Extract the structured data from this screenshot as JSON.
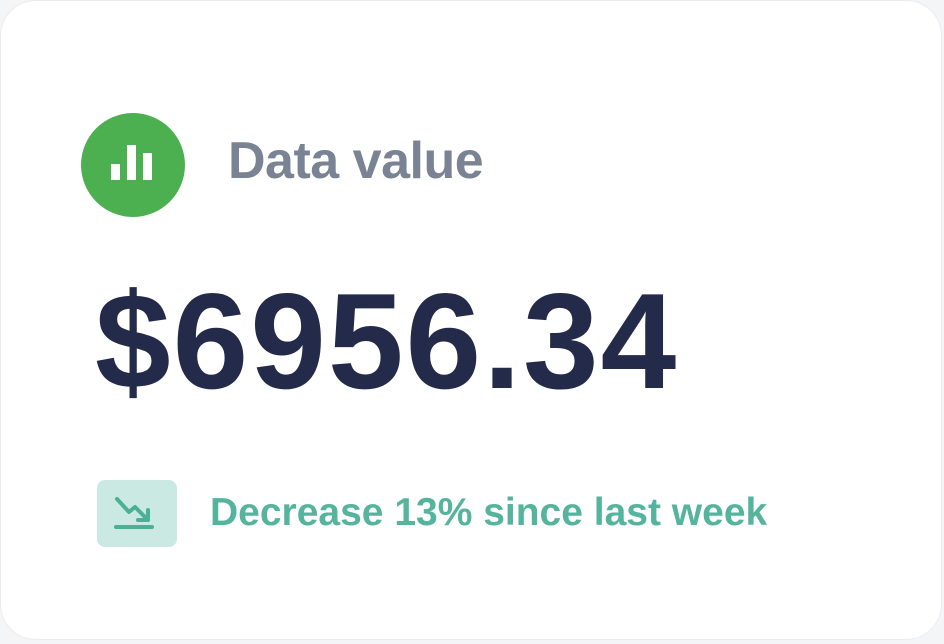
{
  "card": {
    "title": "Data value",
    "value": "$6956.34",
    "trend": {
      "text": "Decrease 13% since last week",
      "icon": "trend-down-icon",
      "direction": "down"
    },
    "header_icon": "bar-chart-icon"
  },
  "colors": {
    "icon_bg": "#4caf50",
    "title": "#7a8393",
    "value": "#242a4a",
    "trend_text": "#55b49e",
    "trend_badge_bg": "#cbe9e3",
    "trend_icon": "#4caf96"
  }
}
